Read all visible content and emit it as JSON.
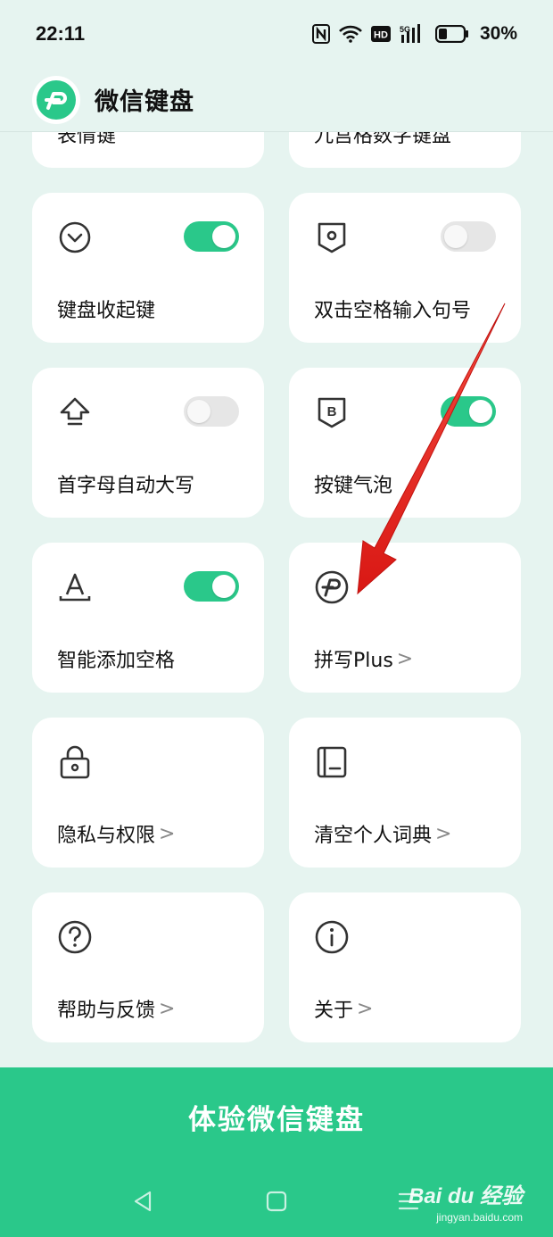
{
  "status_bar": {
    "time": "22:11",
    "battery_percent": "30%",
    "icons": [
      "nfc-icon",
      "wifi-icon",
      "hd-icon",
      "5g-signal-icon",
      "battery-icon"
    ]
  },
  "header": {
    "title": "微信键盘",
    "logo_icon": "wechat-keyboard-logo-icon"
  },
  "cards": [
    {
      "label": "表情键",
      "icon": "none",
      "partial": true
    },
    {
      "label": "九宫格数字键盘",
      "icon": "none",
      "partial": true
    },
    {
      "label": "键盘收起键",
      "icon": "chevron-circle-icon",
      "toggle": true,
      "toggle_on": true
    },
    {
      "label": "双击空格输入句号",
      "icon": "dot-tag-icon",
      "toggle": true,
      "toggle_on": false
    },
    {
      "label": "首字母自动大写",
      "icon": "shift-arrow-icon",
      "toggle": true,
      "toggle_on": false
    },
    {
      "label": "按键气泡",
      "icon": "b-tag-icon",
      "toggle": true,
      "toggle_on": true
    },
    {
      "label": "智能添加空格",
      "icon": "letter-a-icon",
      "toggle": true,
      "toggle_on": true
    },
    {
      "label": "拼写Plus",
      "icon": "plus-circle-logo-icon",
      "chevron": ">"
    },
    {
      "label": "隐私与权限",
      "icon": "lock-icon",
      "chevron": ">"
    },
    {
      "label": "清空个人词典",
      "icon": "book-icon",
      "chevron": ">"
    },
    {
      "label": "帮助与反馈",
      "icon": "question-circle-icon",
      "chevron": ">"
    },
    {
      "label": "关于",
      "icon": "info-circle-icon",
      "chevron": ">"
    }
  ],
  "cta": {
    "label": "体验微信键盘"
  },
  "watermark": {
    "main": "Bai du 经验",
    "sub": "jingyan.baidu.com"
  },
  "colors": {
    "accent": "#2ac88a",
    "background": "#e6f4f0",
    "annotation_arrow": "#e8211e"
  }
}
